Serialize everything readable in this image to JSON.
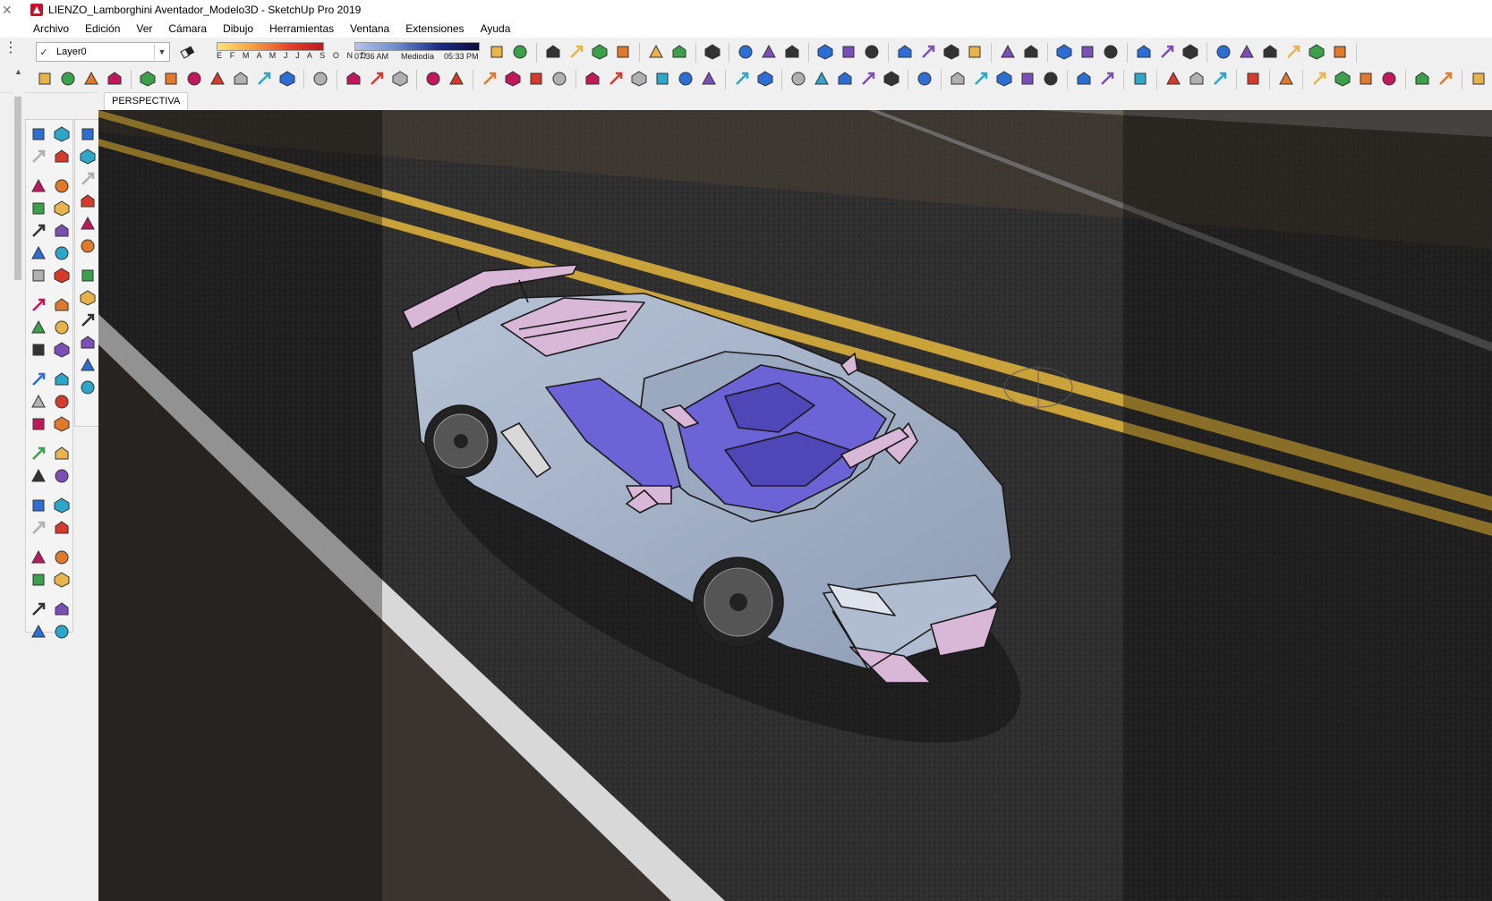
{
  "window": {
    "title": "LIENZO_Lamborghini Aventador_Modelo3D - SketchUp Pro 2019"
  },
  "menu": {
    "items": [
      "Archivo",
      "Edición",
      "Ver",
      "Cámara",
      "Dibujo",
      "Herramientas",
      "Ventana",
      "Extensiones",
      "Ayuda"
    ]
  },
  "layers": {
    "current": "Layer0"
  },
  "shadows": {
    "months": "E F M A M J J A S O N D",
    "time_start": "07:36 AM",
    "time_mid": "Mediodía",
    "time_end": "05:33 PM"
  },
  "scene": {
    "tab_label": "PERSPECTIVA"
  },
  "colors": {
    "car_body": "#a9b7cc",
    "car_trim": "#d9b7d6",
    "car_interior": "#6b63d6",
    "road": "#2f2f2f",
    "road_line_yellow": "#c9a23a",
    "road_line_white": "#d8d8d8"
  }
}
